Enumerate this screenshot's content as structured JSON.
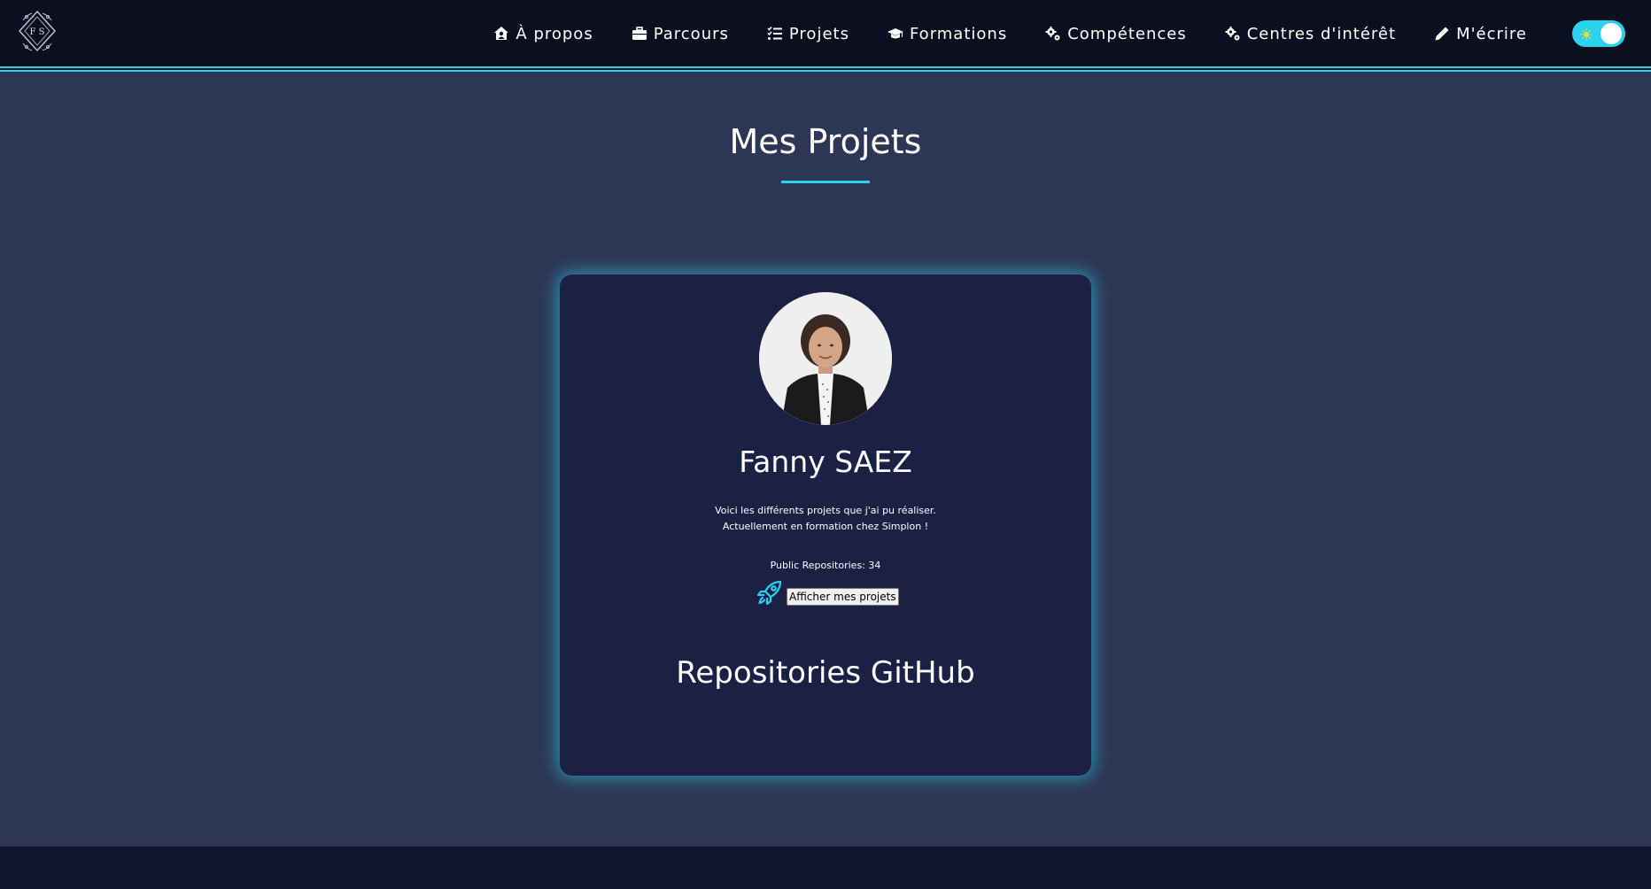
{
  "nav": {
    "items": [
      {
        "label": "À propos",
        "icon": "home-user-icon"
      },
      {
        "label": "Parcours",
        "icon": "briefcase-icon"
      },
      {
        "label": "Projets",
        "icon": "list-check-icon"
      },
      {
        "label": "Formations",
        "icon": "graduation-cap-icon"
      },
      {
        "label": "Compétences",
        "icon": "gears-icon"
      },
      {
        "label": "Centres d'intérêt",
        "icon": "gears-icon"
      },
      {
        "label": "M'écrire",
        "icon": "pencil-icon"
      }
    ],
    "theme_toggle": {
      "state": "light",
      "icon": "sun-icon"
    }
  },
  "page": {
    "title": "Mes Projets"
  },
  "card": {
    "name": "Fanny SAEZ",
    "description_lines": [
      "Voici les différents projets que j'ai pu réaliser.",
      "Actuellement en formation chez Simplon !"
    ],
    "repos_label": "Public Repositories: 34",
    "button_label": "Afficher mes projets",
    "repos_heading": "Repositories GitHub"
  },
  "colors": {
    "accent": "#2ad2f0",
    "nav_bg": "#0b0f20",
    "page_bg": "#2e3655",
    "card_bg": "#1a2145",
    "footer_bg": "#11152e"
  }
}
